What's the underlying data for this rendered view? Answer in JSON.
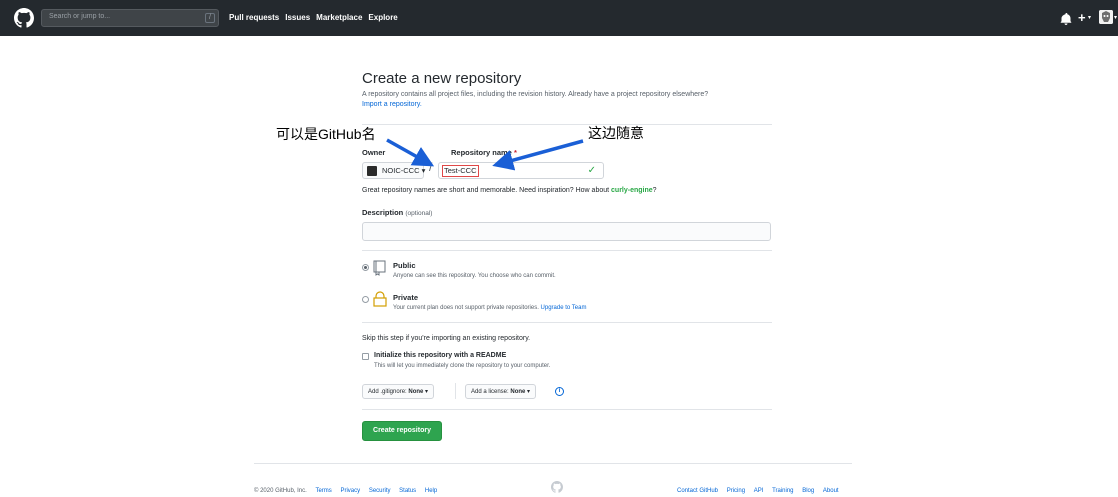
{
  "header": {
    "search_placeholder": "Search or jump to...",
    "search_shortcut": "/",
    "nav": [
      "Pull requests",
      "Issues",
      "Marketplace",
      "Explore"
    ]
  },
  "page": {
    "title": "Create a new repository",
    "subtitle": "A repository contains all project files, including the revision history. Already have a project repository elsewhere?",
    "import_link": "Import a repository."
  },
  "form": {
    "owner_label": "Owner",
    "repo_label": "Repository name",
    "required_mark": "*",
    "owner_value": "NOIC-CCC",
    "separator": "/",
    "repo_value": "Test-CCC",
    "hint_prefix": "Great repository names are short and memorable. Need inspiration? How about",
    "hint_suggestion": "curly-engine",
    "hint_suffix": "?",
    "description_label": "Description",
    "description_optional": "(optional)",
    "public_title": "Public",
    "public_desc": "Anyone can see this repository. You choose who can commit.",
    "private_title": "Private",
    "private_desc": "Your current plan does not support private repositories.",
    "private_upgrade": "Upgrade to Team",
    "skip_text": "Skip this step if you're importing an existing repository.",
    "readme_title": "Initialize this repository with a README",
    "readme_desc": "This will let you immediately clone the repository to your computer.",
    "gitignore_prefix": "Add .gitignore:",
    "gitignore_value": "None",
    "license_prefix": "Add a license:",
    "license_value": "None",
    "create_button": "Create repository"
  },
  "annotations": {
    "left": "可以是GitHub名",
    "right": "这边随意"
  },
  "footer": {
    "copyright": "© 2020 GitHub, Inc.",
    "left_links": [
      "Terms",
      "Privacy",
      "Security",
      "Status",
      "Help"
    ],
    "right_links": [
      "Contact GitHub",
      "Pricing",
      "API",
      "Training",
      "Blog",
      "About"
    ]
  },
  "colors": {
    "header_bg": "#24292e",
    "link": "#0366d6",
    "success": "#28a745",
    "button_green": "#2ea44f",
    "annotation_arrow": "#1a5fd6",
    "highlight_red": "#e04848"
  }
}
